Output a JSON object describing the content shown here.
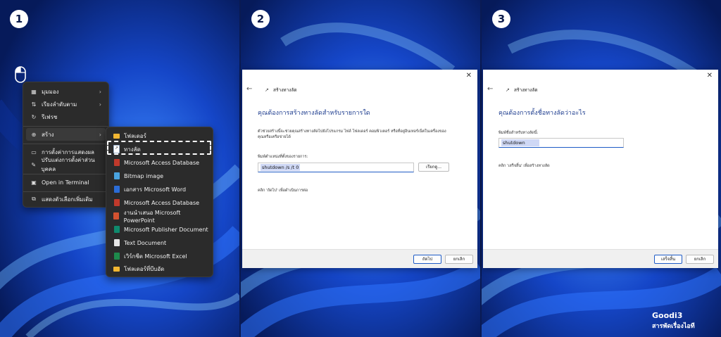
{
  "steps": [
    "1",
    "2",
    "3"
  ],
  "context_menu": {
    "items": [
      {
        "label": "มุมมอง",
        "icon": "grid-icon",
        "submenu": true
      },
      {
        "label": "เรียงลำดับตาม",
        "icon": "sort-icon",
        "submenu": true
      },
      {
        "label": "รีเฟรช",
        "icon": "refresh-icon",
        "submenu": false
      },
      {
        "label": "สร้าง",
        "icon": "new-icon",
        "submenu": true
      },
      {
        "label": "การตั้งค่าการแสดงผล",
        "icon": "display-icon",
        "submenu": false
      },
      {
        "label": "ปรับแต่งการตั้งค่าส่วนบุคคล",
        "icon": "pencil-icon",
        "submenu": false
      },
      {
        "label": "Open in Terminal",
        "icon": "terminal-icon",
        "submenu": false
      },
      {
        "label": "แสดงตัวเลือกเพิ่มเติม",
        "icon": "more-options-icon",
        "submenu": false
      }
    ]
  },
  "new_submenu": {
    "items": [
      {
        "label": "โฟลเดอร์",
        "icon": "folder-icon",
        "color": "#f2b632"
      },
      {
        "label": "ทางลัด",
        "icon": "shortcut-icon",
        "color": "#9bb0c8"
      },
      {
        "label": "Microsoft Access Database",
        "icon": "access-icon",
        "color": "#c0392b"
      },
      {
        "label": "Bitmap image",
        "icon": "bitmap-icon",
        "color": "#4aa3df"
      },
      {
        "label": "เอกสาร Microsoft Word",
        "icon": "word-icon",
        "color": "#2b6cd6"
      },
      {
        "label": "Microsoft Access Database",
        "icon": "access-icon",
        "color": "#c0392b"
      },
      {
        "label": "งานนำเสนอ Microsoft PowerPoint",
        "icon": "powerpoint-icon",
        "color": "#d35230"
      },
      {
        "label": "Microsoft Publisher Document",
        "icon": "publisher-icon",
        "color": "#0f8a6d"
      },
      {
        "label": "Text Document",
        "icon": "text-doc-icon",
        "color": "#e6e6e6"
      },
      {
        "label": "เวิร์กชีต Microsoft Excel",
        "icon": "excel-icon",
        "color": "#1e8a4c"
      },
      {
        "label": "โฟลเดอร์ที่บีบอัด",
        "icon": "zip-folder-icon",
        "color": "#f2b632"
      }
    ]
  },
  "dialog1": {
    "window_title": "สร้างทางลัด",
    "heading": "คุณต้องการสร้างทางลัดสำหรับรายการใด",
    "description_1": "ตัวช่วยสร้างนี้จะช่วยคุณสร้างทางลัดไปยังโปรแกรม ไฟล์ โฟลเดอร์ คอมพิวเตอร์ หรือที่อยู่อินเทอร์เน็ตในเครื่องของ",
    "description_2": "คุณหรือเครือข่ายได้",
    "field_label": "พิมพ์ตำแหน่งที่ตั้งของรายการ:",
    "field_value": "shutdown /s /t 0",
    "browse_label": "เรียกดู...",
    "hint": "คลิก 'ถัดไป' เพื่อดำเนินการต่อ",
    "next_label": "ถัดไป",
    "cancel_label": "ยกเลิก"
  },
  "dialog2": {
    "window_title": "สร้างทางลัด",
    "heading": "คุณต้องการตั้งชื่อทางลัดว่าอะไร",
    "field_label": "พิมพ์ชื่อสำหรับทางลัดนี้:",
    "field_value": "shutdown",
    "hint": "คลิก 'เสร็จสิ้น' เพื่อสร้างทางลัด",
    "finish_label": "เสร็จสิ้น",
    "cancel_label": "ยกเลิก"
  },
  "brand": {
    "line1": "Goodi3",
    "line2": "สารพัดเรื่องไอที"
  },
  "colors": {
    "accent": "#1e5bc6",
    "heading": "#1e3d8f",
    "menu_bg": "#2b2b2b"
  }
}
